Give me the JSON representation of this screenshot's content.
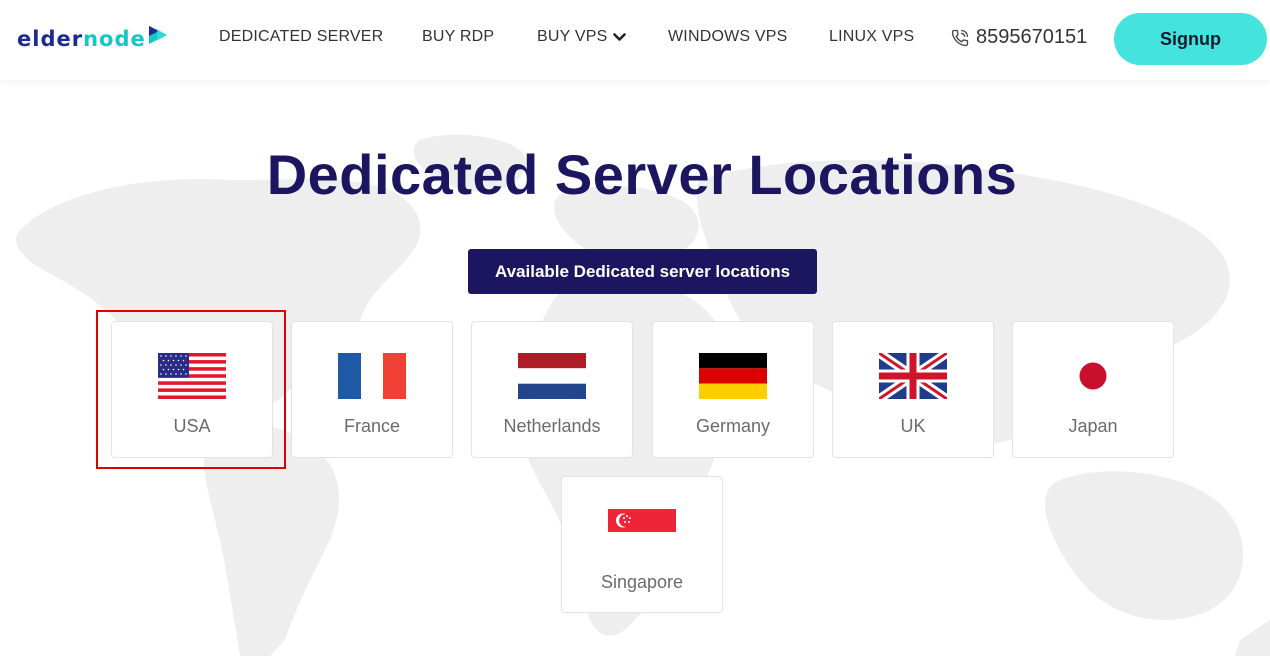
{
  "header": {
    "logo": {
      "part1": "elder",
      "part2": "node"
    },
    "nav": [
      {
        "label": "DEDICATED SERVER"
      },
      {
        "label": "BUY RDP"
      },
      {
        "label": "BUY VPS",
        "icon": "chevron-down-icon"
      },
      {
        "label": "WINDOWS VPS"
      },
      {
        "label": "LINUX VPS"
      }
    ],
    "phone": {
      "icon": "phone-icon",
      "number": "8595670151"
    },
    "signup_label": "Signup"
  },
  "main": {
    "title": "Dedicated Server Locations",
    "available_label": "Available Dedicated server locations",
    "locations": [
      {
        "name": "USA",
        "flag": "usa-flag",
        "selected": true
      },
      {
        "name": "France",
        "flag": "france-flag"
      },
      {
        "name": "Netherlands",
        "flag": "netherlands-flag"
      },
      {
        "name": "Germany",
        "flag": "germany-flag"
      },
      {
        "name": "UK",
        "flag": "uk-flag"
      },
      {
        "name": "Japan",
        "flag": "japan-flag"
      },
      {
        "name": "Singapore",
        "flag": "singapore-flag"
      }
    ]
  },
  "colors": {
    "brand_dark": "#1c1660",
    "brand_teal": "#44e3dd",
    "logo_blue": "#1d2b8f",
    "highlight_red": "#e00000"
  }
}
